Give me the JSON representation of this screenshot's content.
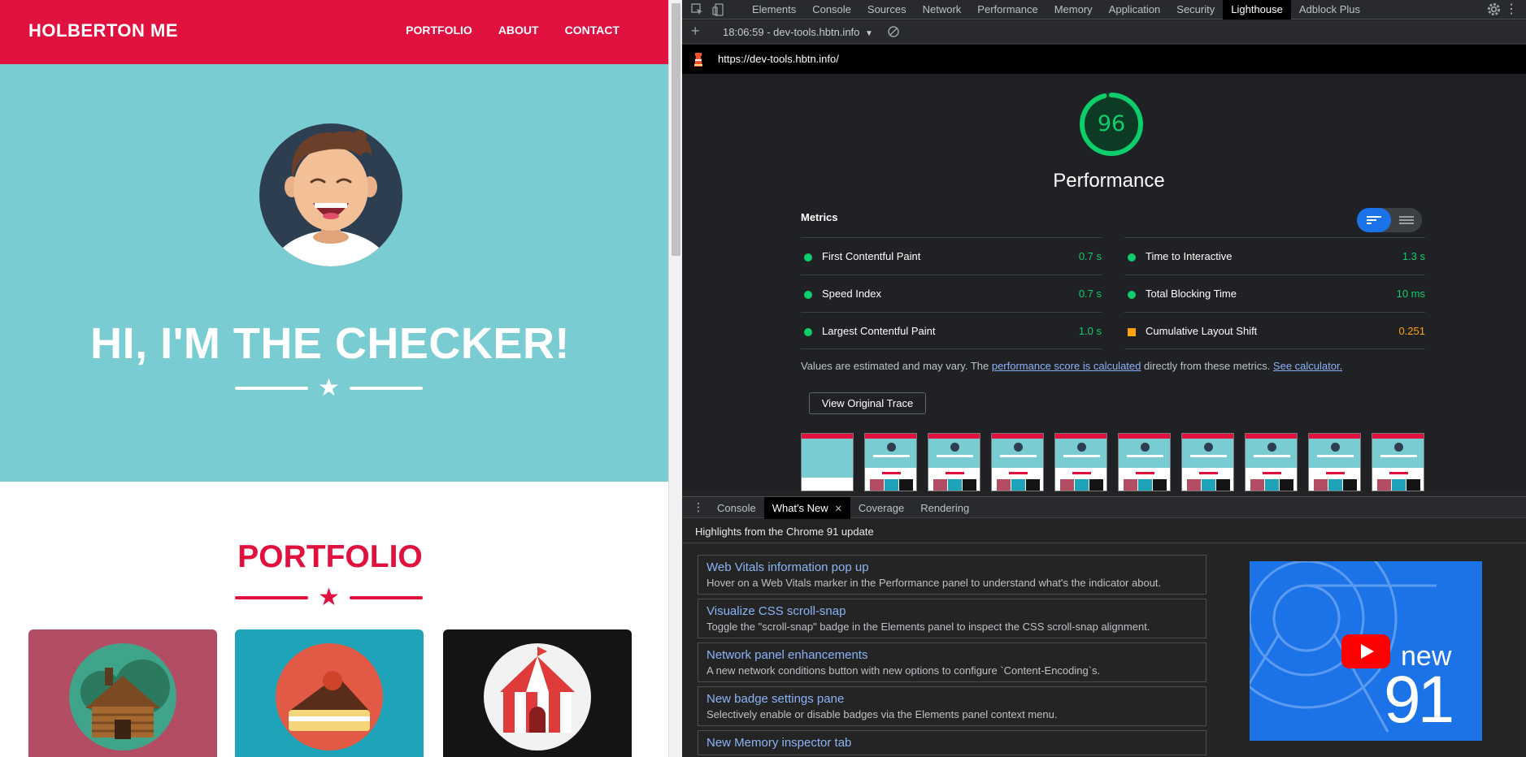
{
  "site": {
    "brand": "HOLBERTON ME",
    "nav": [
      "PORTFOLIO",
      "ABOUT",
      "CONTACT"
    ],
    "hero_title": "HI, I'M THE CHECKER!",
    "portfolio_title": "PORTFOLIO",
    "colors": {
      "primary": "#e0103f",
      "hero_bg": "#79cdd2"
    }
  },
  "devtools": {
    "tabs": [
      "Elements",
      "Console",
      "Sources",
      "Network",
      "Performance",
      "Memory",
      "Application",
      "Security",
      "Lighthouse",
      "Adblock Plus"
    ],
    "active_tab": "Lighthouse",
    "report_select": "18:06:59 - dev-tools.hbtn.info",
    "url": "https://dev-tools.hbtn.info/",
    "score": "96",
    "score_fraction": 0.96,
    "category": "Performance",
    "metrics_title": "Metrics",
    "metrics_left": [
      {
        "name": "First Contentful Paint",
        "value": "0.7 s",
        "status": "pass"
      },
      {
        "name": "Speed Index",
        "value": "0.7 s",
        "status": "pass"
      },
      {
        "name": "Largest Contentful Paint",
        "value": "1.0 s",
        "status": "pass"
      }
    ],
    "metrics_right": [
      {
        "name": "Time to Interactive",
        "value": "1.3 s",
        "status": "pass"
      },
      {
        "name": "Total Blocking Time",
        "value": "10 ms",
        "status": "pass"
      },
      {
        "name": "Cumulative Layout Shift",
        "value": "0.251",
        "status": "average"
      }
    ],
    "note": {
      "prefix": "Values are estimated and may vary. The ",
      "link1": "performance score is calculated",
      "middle": " directly from these metrics. ",
      "link2": "See calculator."
    },
    "trace_button": "View Original Trace",
    "drawer_tabs": [
      "Console",
      "What's New",
      "Coverage",
      "Rendering"
    ],
    "drawer_active": "What's New",
    "whats_new_header": "Highlights from the Chrome 91 update",
    "whats_new_items": [
      {
        "title": "Web Vitals information pop up",
        "desc": "Hover on a Web Vitals marker in the Performance panel to understand what's the indicator about."
      },
      {
        "title": "Visualize CSS scroll-snap",
        "desc": "Toggle the \"scroll-snap\" badge in the Elements panel to inspect the CSS scroll-snap alignment."
      },
      {
        "title": "Network panel enhancements",
        "desc": "A new network conditions button with new options to configure `Content-Encoding`s."
      },
      {
        "title": "New badge settings pane",
        "desc": "Selectively enable or disable badges via the Elements panel context menu."
      },
      {
        "title": "New Memory inspector tab",
        "desc": ""
      }
    ],
    "video": {
      "word": "new",
      "number": "91"
    },
    "colors": {
      "pass": "#0cce6b",
      "average": "#ffa400",
      "link": "#8ab4f8",
      "accent": "#1a73e8"
    }
  }
}
